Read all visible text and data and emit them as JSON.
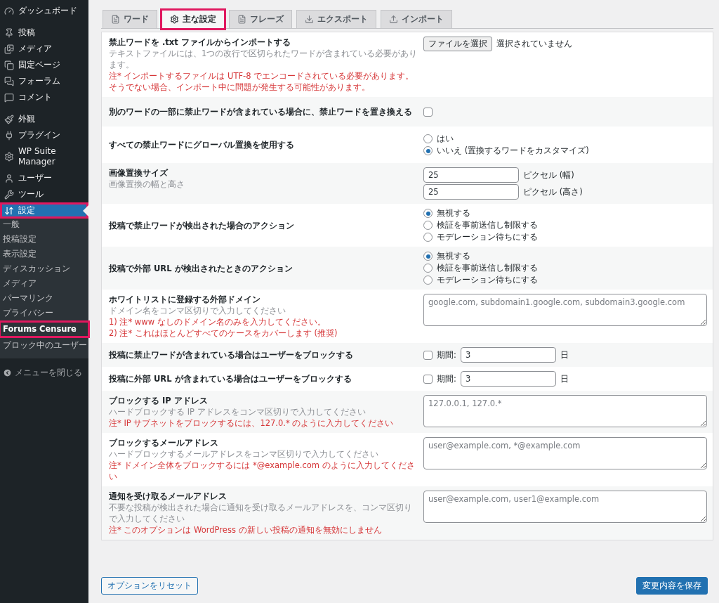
{
  "sidebar": {
    "groups": [
      [
        {
          "label": "ダッシュボード",
          "selected": false,
          "highlighted": false
        }
      ],
      [
        {
          "label": "投稿",
          "selected": false,
          "highlighted": false
        },
        {
          "label": "メディア",
          "selected": false,
          "highlighted": false
        },
        {
          "label": "固定ページ",
          "selected": false,
          "highlighted": false
        },
        {
          "label": "フォーラム",
          "selected": false,
          "highlighted": false
        },
        {
          "label": "コメント",
          "selected": false,
          "highlighted": false
        }
      ],
      [
        {
          "label": "外観",
          "selected": false,
          "highlighted": false
        },
        {
          "label": "プラグイン",
          "selected": false,
          "highlighted": false
        },
        {
          "label": "WP Suite Manager",
          "selected": false,
          "highlighted": false
        },
        {
          "label": "ユーザー",
          "selected": false,
          "highlighted": false
        },
        {
          "label": "ツール",
          "selected": false,
          "highlighted": false
        },
        {
          "label": "設定",
          "selected": true,
          "highlighted": true
        }
      ]
    ],
    "submenu": [
      {
        "label": "一般",
        "selected": false,
        "highlighted": false
      },
      {
        "label": "投稿設定",
        "selected": false,
        "highlighted": false
      },
      {
        "label": "表示設定",
        "selected": false,
        "highlighted": false
      },
      {
        "label": "ディスカッション",
        "selected": false,
        "highlighted": false
      },
      {
        "label": "メディア",
        "selected": false,
        "highlighted": false
      },
      {
        "label": "パーマリンク",
        "selected": false,
        "highlighted": false
      },
      {
        "label": "プライバシー",
        "selected": false,
        "highlighted": false
      },
      {
        "label": "Forums Censure",
        "selected": true,
        "highlighted": true
      },
      {
        "label": "ブロック中のユーザー",
        "selected": false,
        "highlighted": false
      }
    ],
    "collapse": "メニューを閉じる"
  },
  "tabs": [
    {
      "label": "ワード",
      "selected": false,
      "highlighted": false
    },
    {
      "label": "主な設定",
      "selected": true,
      "highlighted": true
    },
    {
      "label": "フレーズ",
      "selected": false,
      "highlighted": false
    },
    {
      "label": "エクスポート",
      "selected": false,
      "highlighted": false
    },
    {
      "label": "インポート",
      "selected": false,
      "highlighted": false
    }
  ],
  "settings": [
    {
      "label": "禁止ワードを .txt ファイルからインポートする",
      "description": "テキストファイルには、1つの改行で区切られたワードが含まれている必要があります。",
      "notes": [
        "注* インポートするファイルは UTF-8 でエンコードされている必要があります。そうでない場合、インポート中に問題が発生する可能性があります。"
      ],
      "control": {
        "kind": "file",
        "button": "ファイルを選択",
        "status": "選択されていません"
      }
    },
    {
      "label": "別のワードの一部に禁止ワードが含まれている場合に、禁止ワードを置き換える",
      "control": {
        "kind": "checkbox",
        "checked": false
      }
    },
    {
      "label": "すべての禁止ワードにグローバル置換を使用する",
      "control": {
        "kind": "radio",
        "options": [
          {
            "label": "はい",
            "selected": false
          },
          {
            "label": "いいえ (置換するワードをカスタマイズ)",
            "selected": true
          }
        ]
      }
    },
    {
      "label": "画像置換サイズ",
      "description": "画像置換の幅と高さ",
      "control": {
        "kind": "size",
        "fields": [
          {
            "value": "25",
            "unit": "ピクセル (幅)"
          },
          {
            "value": "25",
            "unit": "ピクセル (高さ)"
          }
        ]
      }
    },
    {
      "label": "投稿で禁止ワードが検出された場合のアクション",
      "control": {
        "kind": "radio",
        "options": [
          {
            "label": "無視する",
            "selected": true
          },
          {
            "label": "検証を事前送信し制限する",
            "selected": false
          },
          {
            "label": "モデレーション待ちにする",
            "selected": false
          }
        ]
      }
    },
    {
      "label": "投稿で外部 URL が検出されたときのアクション",
      "control": {
        "kind": "radio",
        "options": [
          {
            "label": "無視する",
            "selected": true
          },
          {
            "label": "検証を事前送信し制限する",
            "selected": false
          },
          {
            "label": "モデレーション待ちにする",
            "selected": false
          }
        ]
      }
    },
    {
      "label": "ホワイトリストに登録する外部ドメイン",
      "description": "ドメイン名をコンマ区切りで入力してください",
      "notes": [
        "1) 注* www なしのドメイン名のみを入力してください。",
        "2) 注* これはほとんどすべてのケースをカバーします (推奨)"
      ],
      "control": {
        "kind": "textarea",
        "placeholder": "google.com, subdomain1.google.com, subdomain3.google.com"
      }
    },
    {
      "label": "投稿に禁止ワードが含まれている場合はユーザーをブロックする",
      "control": {
        "kind": "block",
        "checked": false,
        "field_label": "期間:",
        "value": "3",
        "unit": "日"
      }
    },
    {
      "label": "投稿に外部 URL が含まれている場合はユーザーをブロックする",
      "control": {
        "kind": "block",
        "checked": false,
        "field_label": "期間:",
        "value": "3",
        "unit": "日"
      }
    },
    {
      "label": "ブロックする IP アドレス",
      "description": "ハードブロックする IP アドレスをコンマ区切りで入力してください",
      "notes": [
        "注* IP サブネットをブロックするには、127.0.* のように入力してください"
      ],
      "control": {
        "kind": "textarea",
        "placeholder": "127.0.0.1, 127.0.*"
      }
    },
    {
      "label": "ブロックするメールアドレス",
      "description": "ハードブロックするメールアドレスをコンマ区切りで入力してください",
      "notes": [
        "注* ドメイン全体をブロックするには *@example.com のように入力してください"
      ],
      "control": {
        "kind": "textarea",
        "placeholder": "user@example.com, *@example.com"
      }
    },
    {
      "label": "通知を受け取るメールアドレス",
      "description": "不要な投稿が検出された場合に通知を受け取るメールアドレスを、コンマ区切りで入力してください",
      "notes": [
        "注* このオプションは WordPress の新しい投稿の通知を無効にしません"
      ],
      "control": {
        "kind": "textarea",
        "placeholder": "user@example.com, user1@example.com"
      }
    }
  ],
  "buttons": {
    "reset": "オプションをリセット",
    "save": "変更内容を保存"
  }
}
